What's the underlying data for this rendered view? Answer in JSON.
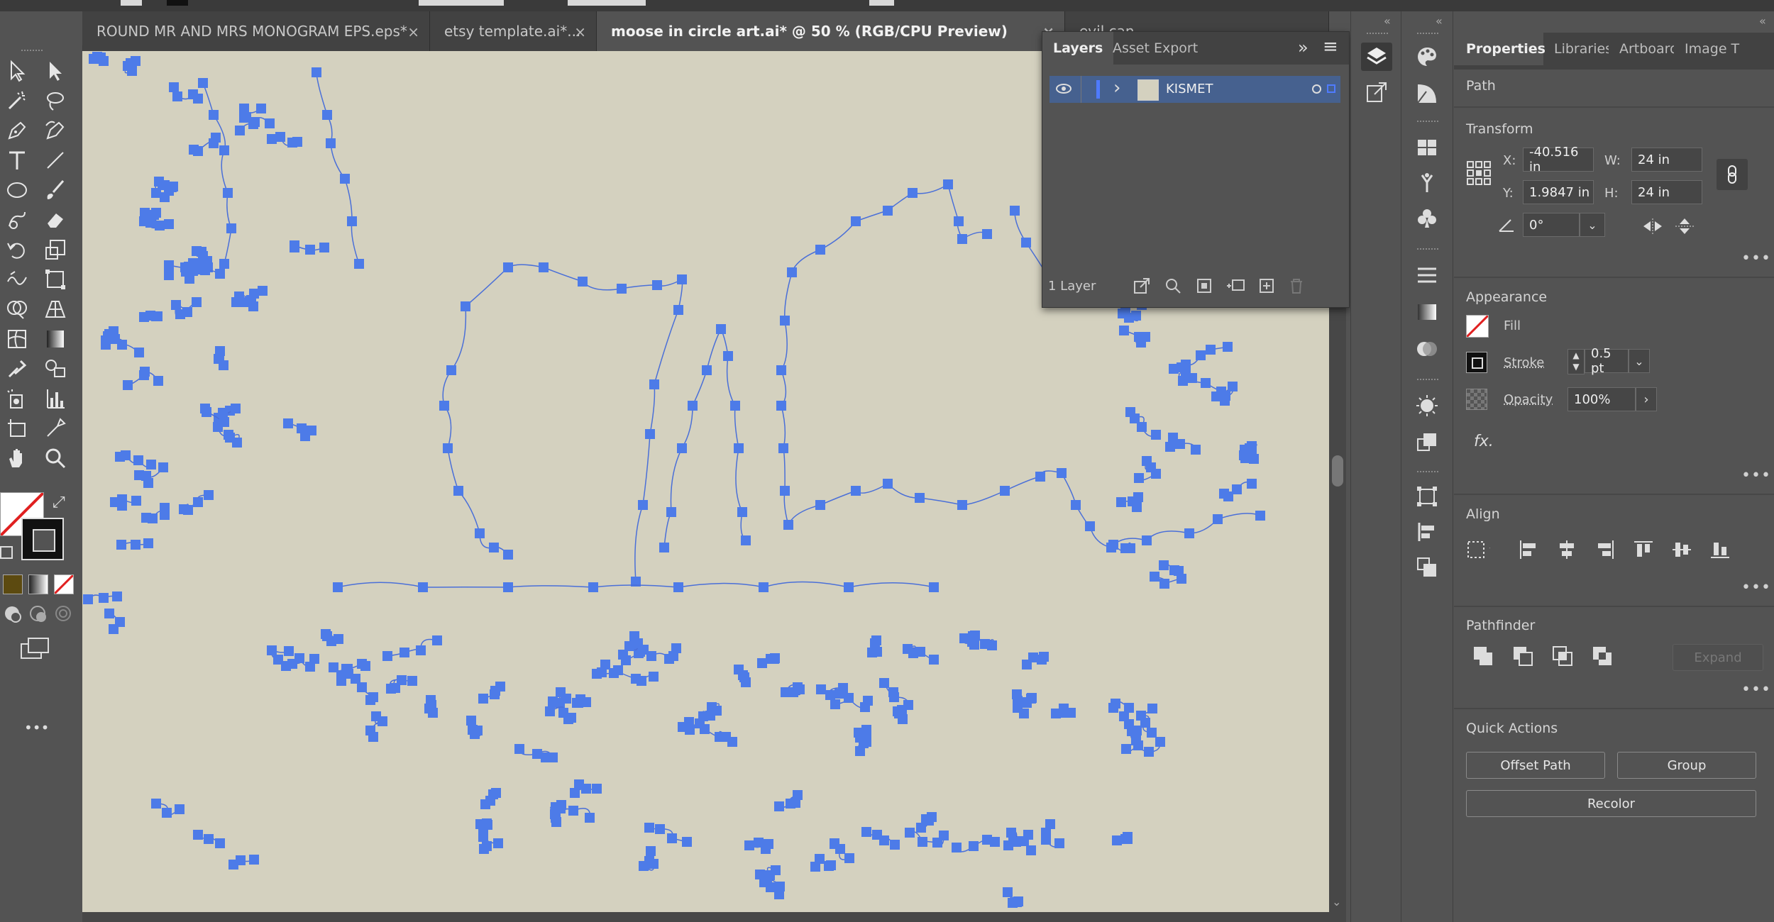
{
  "tabs": [
    {
      "label": "ROUND MR AND MRS MONOGRAM EPS.eps*",
      "active": false
    },
    {
      "label": "etsy template.ai*...",
      "active": false
    },
    {
      "label": "moose in circle art.ai* @ 50 % (RGB/CPU Preview)",
      "active": true
    },
    {
      "label": "evil can",
      "active": false
    }
  ],
  "close_glyph": "×",
  "layers_panel": {
    "tabs": [
      "Layers",
      "Asset Export"
    ],
    "expand_glyph": "»",
    "menu_glyph": "≡",
    "layer_name": "KISMET",
    "chevron": "›",
    "count": "1 Layer"
  },
  "collapse_glyph": "«",
  "properties": {
    "tabs": [
      "Properties",
      "Libraries",
      "Artboard",
      "Image T"
    ],
    "object_type": "Path",
    "transform": {
      "title": "Transform",
      "x_label": "X:",
      "x": "-40.516 in",
      "y_label": "Y:",
      "y": "1.9847 in",
      "w_label": "W:",
      "w": "24 in",
      "h_label": "H:",
      "h": "24 in",
      "angle": "0°"
    },
    "appearance": {
      "title": "Appearance",
      "fill_label": "Fill",
      "stroke_label": "Stroke",
      "stroke_value": "0.5 pt",
      "opacity_label": "Opacity",
      "opacity_value": "100%",
      "fx": "fx."
    },
    "align_title": "Align",
    "pathfinder": {
      "title": "Pathfinder",
      "expand": "Expand"
    },
    "quick_actions": {
      "title": "Quick Actions",
      "offset_path": "Offset Path",
      "group": "Group",
      "recolor": "Recolor"
    },
    "more_glyph": "•••"
  },
  "toolbar_more": "•••",
  "colors": {
    "canvas": "#d4d1bf",
    "anchor": "#4d7be8",
    "path": "#4a6fd8",
    "panel": "#535353",
    "dark": "#424242",
    "layer_row": "#46618f"
  }
}
